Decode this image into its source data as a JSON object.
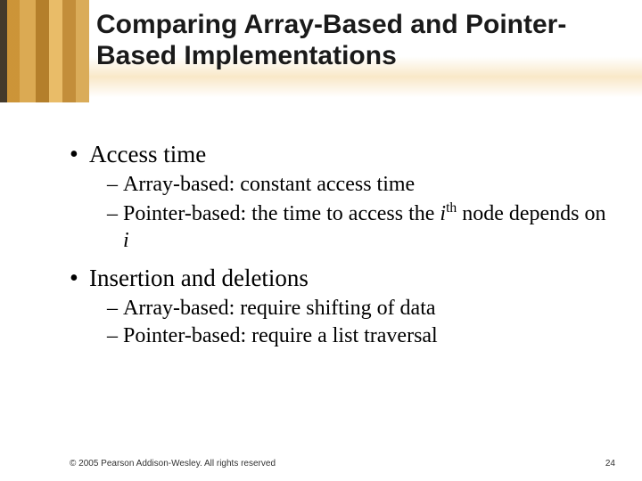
{
  "title": "Comparing Array-Based and Pointer-Based Implementations",
  "bullets": [
    {
      "text": "Access time",
      "subs": [
        {
          "html": "Array-based:  constant access time"
        },
        {
          "html": "Pointer-based: the time to access the <span class=\"i\">i</span><sup>th</sup> node depends on <span class=\"i\">i</span>"
        }
      ]
    },
    {
      "text": "Insertion and deletions",
      "subs": [
        {
          "html": "Array-based: require shifting of data"
        },
        {
          "html": "Pointer-based: require a list traversal"
        }
      ]
    }
  ],
  "footer": {
    "copyright": "© 2005 Pearson Addison-Wesley. All rights reserved",
    "page": "24"
  }
}
